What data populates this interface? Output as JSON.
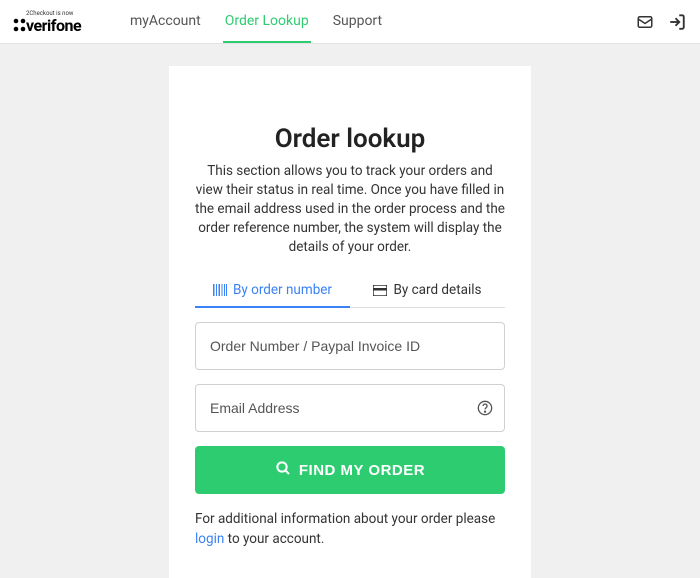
{
  "brand": {
    "prefix": "2Checkout is now",
    "name": "verifone"
  },
  "nav": {
    "items": [
      {
        "label": "myAccount",
        "active": false
      },
      {
        "label": "Order Lookup",
        "active": true
      },
      {
        "label": "Support",
        "active": false
      }
    ]
  },
  "page": {
    "title": "Order lookup",
    "description": "This section allows you to track your orders and view their status in real time. Once you have filled in the email address used in the order process and the order reference number, the system will display the details of your order."
  },
  "tabs": {
    "byOrder": "By order number",
    "byCard": "By card details"
  },
  "form": {
    "orderPlaceholder": "Order Number / Paypal Invoice ID",
    "emailPlaceholder": "Email Address",
    "submit": "Find my order"
  },
  "footnote": {
    "prefix": "For additional information about your order please ",
    "login": "login",
    "suffix": " to your account."
  }
}
